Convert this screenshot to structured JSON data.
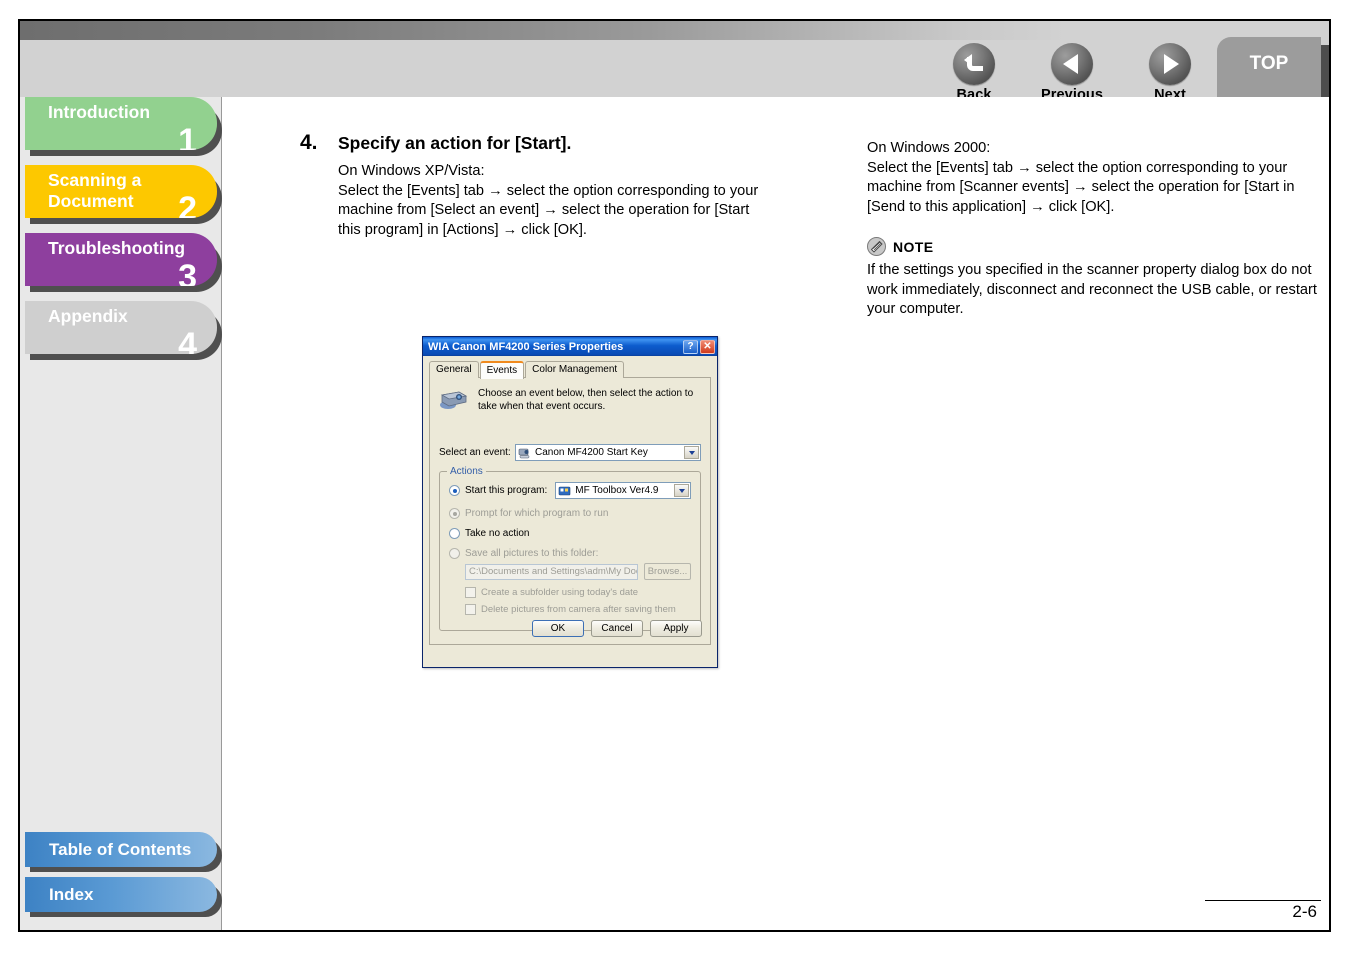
{
  "header": {
    "nav": [
      {
        "label": "Back",
        "icon": "back-arrow-icon"
      },
      {
        "label": "Previous",
        "icon": "left-triangle-icon"
      },
      {
        "label": "Next",
        "icon": "right-triangle-icon"
      }
    ],
    "top_tab": "TOP"
  },
  "sidebar": {
    "chapters": [
      {
        "label": "Introduction",
        "number": "1",
        "color": "#92d18f"
      },
      {
        "label": "Scanning a Document",
        "number": "2",
        "color": "#fdc800"
      },
      {
        "label": "Troubleshooting",
        "number": "3",
        "color": "#8e3f9e"
      },
      {
        "label": "Appendix",
        "number": "4",
        "color": "#cfcfcf"
      }
    ],
    "bottom": [
      {
        "label": "Table of Contents"
      },
      {
        "label": "Index"
      }
    ]
  },
  "main": {
    "step_number": "4.",
    "step_title": "Specify an action for [Start].",
    "left_lines": [
      "On Windows XP/Vista:",
      "Select the [Events] tab → select the option corresponding to your machine from [Select an event] → select the operation for [Start this program] in [Actions] → click [OK]."
    ],
    "right_lines": [
      "On Windows 2000:",
      "Select the [Events] tab → select the option corresponding to your machine from [Scanner events] → select the operation for [Start in [Send to this application] → click [OK]."
    ],
    "note": {
      "label": "NOTE",
      "icon": "note-pencil-icon",
      "text": "If the settings you specified in the scanner property dialog box do not work immediately, disconnect and reconnect the USB cable, or restart your computer."
    }
  },
  "dialog": {
    "title": "WIA Canon MF4200 Series Properties",
    "help_button": "?",
    "close_button": "✕",
    "tabs": [
      {
        "label": "General",
        "active": false
      },
      {
        "label": "Events",
        "active": true
      },
      {
        "label": "Color Management",
        "active": false
      }
    ],
    "description": "Choose an event below, then select the action to take when that event occurs.",
    "event_label": "Select an event:",
    "event_value": "Canon MF4200 Start Key",
    "actions_legend": "Actions",
    "actions": {
      "start_program_label": "Start this program:",
      "start_program_value": "MF Toolbox Ver4.9",
      "prompt_label": "Prompt for which program to run",
      "no_action_label": "Take no action",
      "save_pictures_label": "Save all pictures to this folder:",
      "folder_path": "C:\\Documents and Settings\\adm\\My Documents\\",
      "browse_label": "Browse...",
      "subfolder_label": "Create a subfolder using today's date",
      "delete_label": "Delete pictures from camera after saving them"
    },
    "buttons": [
      {
        "label": "OK",
        "default": true
      },
      {
        "label": "Cancel",
        "default": false
      },
      {
        "label": "Apply",
        "default": false
      }
    ]
  },
  "footer": {
    "page_number": "2-6"
  }
}
